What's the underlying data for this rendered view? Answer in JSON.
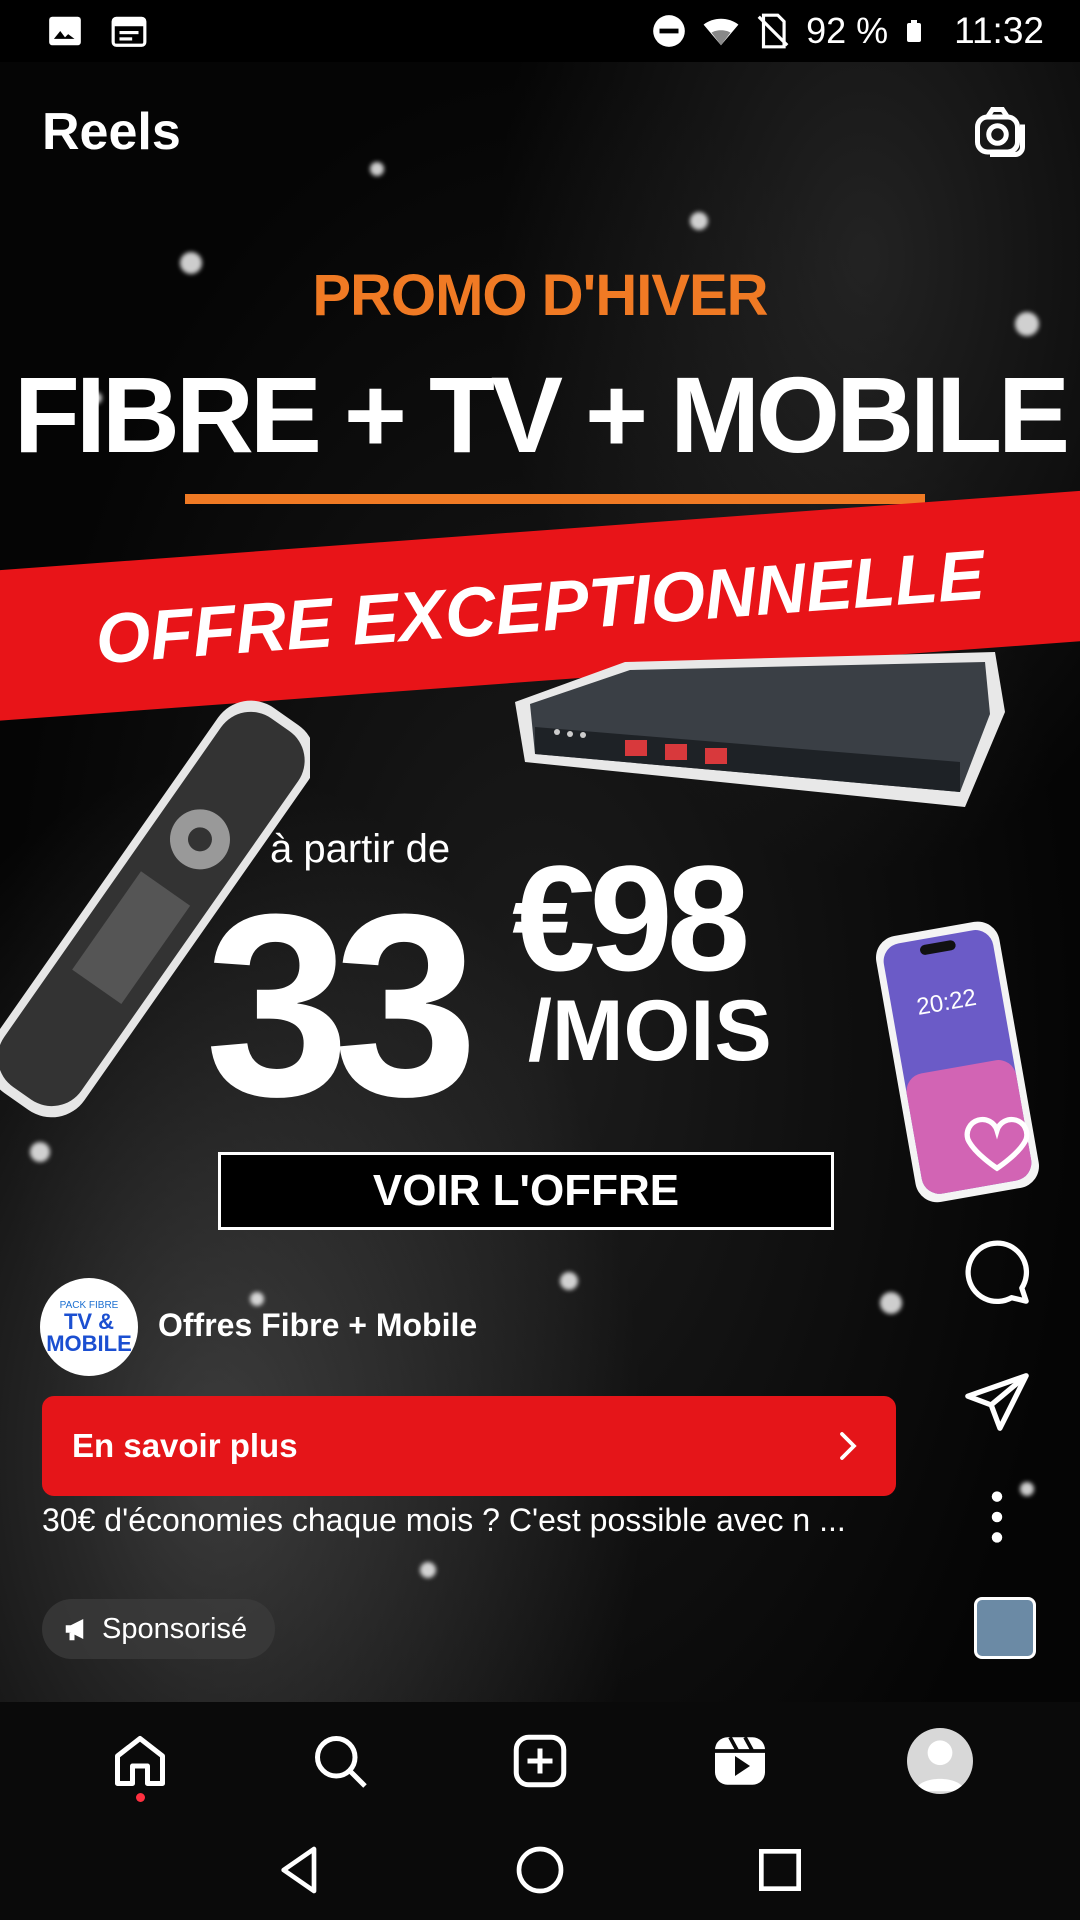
{
  "status_bar": {
    "battery": "92 %",
    "time": "11:32",
    "icons": [
      "gallery-icon",
      "calendar-icon",
      "do-not-disturb-icon",
      "wifi-icon",
      "no-sim-icon",
      "battery-icon"
    ]
  },
  "header": {
    "title": "Reels",
    "camera_icon": "camera-icon"
  },
  "ad": {
    "promo_line": "PROMO D'HIVER",
    "headline": "FIBRE + TV + MOBILE",
    "banner": "OFFRE EXCEPTIONNELLE",
    "from_label": "à partir de",
    "price_main": "33",
    "price_cents": "€98",
    "per_month": "/MOIS",
    "see_offer": "VOIR L'OFFRE",
    "phone_time": "20:22"
  },
  "account": {
    "avatar_line1": "PACK FIBRE",
    "avatar_line2": "TV &",
    "avatar_line3": "MOBILE",
    "name": "Offres Fibre + Mobile"
  },
  "cta": {
    "label": "En savoir plus"
  },
  "caption": "30€ d'économies chaque mois ? C'est possible avec n ...",
  "sponsored_label": "Sponsorisé",
  "actions": [
    "heart-icon",
    "comment-icon",
    "share-icon",
    "more-icon"
  ],
  "bottom_nav": [
    "home-icon",
    "search-icon",
    "create-icon",
    "reels-icon",
    "profile-avatar"
  ],
  "system_nav": [
    "back-icon",
    "home-circle-icon",
    "recents-icon"
  ],
  "colors": {
    "accent_orange": "#f07a24",
    "banner_red": "#e81418",
    "cta_red": "#e51519",
    "notification_dot": "#ff3040"
  }
}
